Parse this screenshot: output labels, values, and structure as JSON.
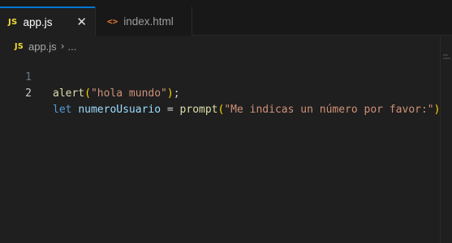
{
  "tabs": [
    {
      "icon": "JS",
      "label": "app.js",
      "close": "✕"
    },
    {
      "icon": "<>",
      "label": "index.html"
    }
  ],
  "breadcrumb": {
    "icon": "JS",
    "file": "app.js",
    "separator": "›",
    "more": "..."
  },
  "editor": {
    "lines": [
      {
        "number": "1"
      },
      {
        "number": "2"
      }
    ],
    "line1": {
      "fn": "alert",
      "open": "(",
      "str": "\"hola mundo\"",
      "close": ")",
      "semi": ";"
    },
    "line2": {
      "kw": "let",
      "var": "numeroUsuario",
      "eq": "=",
      "fn": "prompt",
      "open": "(",
      "str": "\"Me indicas un número por favor:\"",
      "close": ")"
    }
  },
  "colors": {
    "accent": "#0078d4",
    "js_icon": "#f1dd35",
    "html_icon": "#e37933"
  }
}
